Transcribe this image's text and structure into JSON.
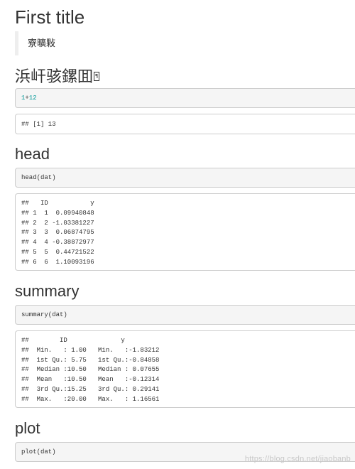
{
  "sections": {
    "first": {
      "title": "First title",
      "quote": "寮曠敤"
    },
    "second": {
      "title": "浜屽骇鏍囬",
      "title_mark": "¶",
      "code_a": "1",
      "code_op": "+",
      "code_b": "12",
      "output": "## [1] 13"
    },
    "head": {
      "title": "head",
      "code": "head(dat)",
      "output": [
        "##   ID           y",
        "## 1  1  0.09940848",
        "## 2  2 -1.03381227",
        "## 3  3  0.06874795",
        "## 4  4 -0.38872977",
        "## 5  5  0.44721522",
        "## 6  6  1.10093196"
      ]
    },
    "summary": {
      "title": "summary",
      "code": "summary(dat)",
      "output": [
        "##        ID              y",
        "##  Min.   : 1.00   Min.   :-1.83212",
        "##  1st Qu.: 5.75   1st Qu.:-0.84858",
        "##  Median :10.50   Median : 0.07655",
        "##  Mean   :10.50   Mean   :-0.12314",
        "##  3rd Qu.:15.25   3rd Qu.: 0.29141",
        "##  Max.   :20.00   Max.   : 1.16561"
      ]
    },
    "plot": {
      "title": "plot",
      "code": "plot(dat)"
    }
  },
  "watermark": "https://blog.csdn.net/jiaobanb"
}
